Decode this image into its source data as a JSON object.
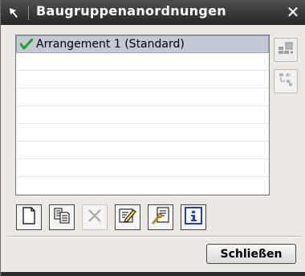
{
  "window": {
    "title": "Baugruppenanordnungen",
    "close_glyph": "✕"
  },
  "arrangements": [
    {
      "label": "Arrangement 1 (Standard)",
      "selected": true,
      "active": true
    },
    {
      "label": ""
    },
    {
      "label": ""
    },
    {
      "label": ""
    },
    {
      "label": ""
    },
    {
      "label": ""
    },
    {
      "label": ""
    },
    {
      "label": ""
    },
    {
      "label": ""
    }
  ],
  "side_buttons": [
    {
      "icon": "add-arrangement-icon",
      "enabled": true
    },
    {
      "icon": "reorder-arrangement-icon",
      "enabled": false
    }
  ],
  "toolbar": [
    {
      "icon": "new-document-icon",
      "enabled": true
    },
    {
      "icon": "copy-icon",
      "enabled": true
    },
    {
      "icon": "delete-icon",
      "enabled": false
    },
    {
      "icon": "rename-icon",
      "enabled": true
    },
    {
      "icon": "properties-icon",
      "enabled": true
    },
    {
      "icon": "info-icon",
      "enabled": true
    }
  ],
  "buttons": {
    "close_label": "Schließen"
  },
  "colors": {
    "titlebar": "#333333",
    "selection": "#c3c9d6",
    "check": "#1f9e2a",
    "info": "#1e3fbf"
  }
}
